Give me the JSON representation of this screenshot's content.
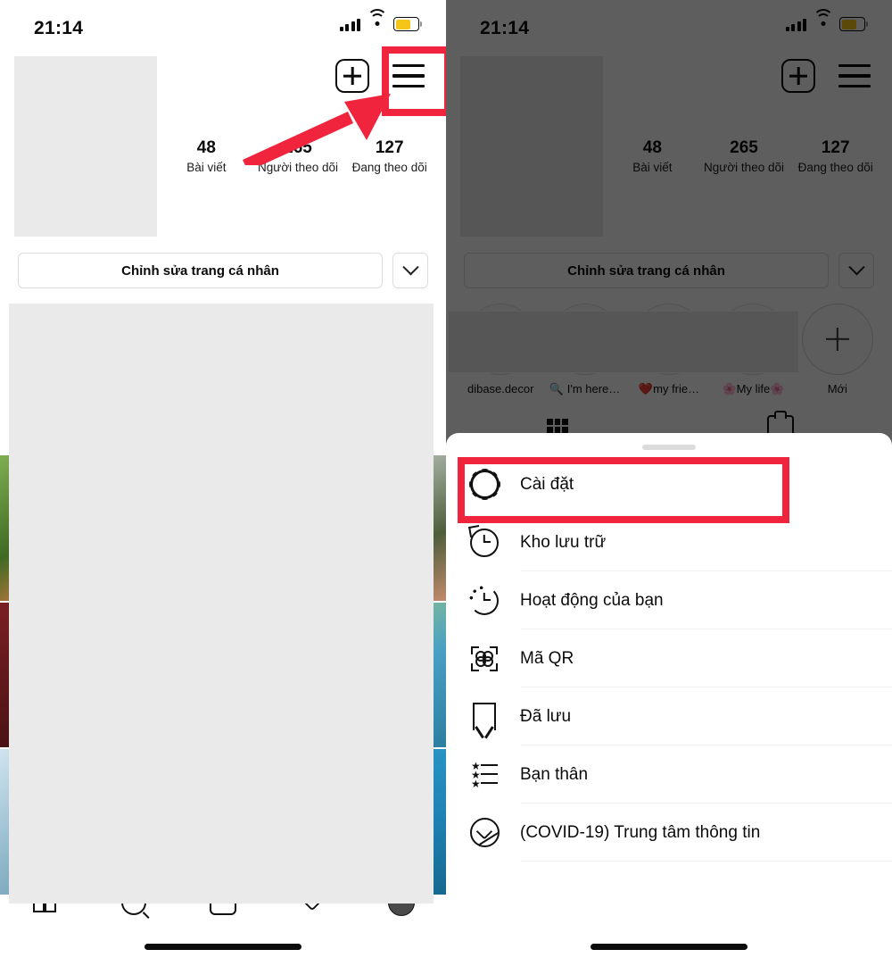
{
  "meta": {
    "app": "Instagram",
    "platform": "iOS",
    "accent_red": "#f0243c",
    "battery_color": "#f5c518"
  },
  "status_bar": {
    "time": "21:14",
    "signal_icon": "cellular-signal-icon",
    "wifi_icon": "wifi-icon",
    "battery_icon": "battery-icon"
  },
  "header": {
    "add_icon": "plus-square-icon",
    "menu_icon": "hamburger-menu-icon"
  },
  "profile": {
    "stats": [
      {
        "value": "48",
        "label": "Bài viết"
      },
      {
        "value": "265",
        "label": "Người theo dõi"
      },
      {
        "value": "127",
        "label": "Đang theo dõi"
      }
    ],
    "edit_button": "Chỉnh sửa trang cá nhân",
    "chevron_icon": "chevron-down-icon",
    "highlights": [
      {
        "name": "dibase.decor",
        "type": "highlight"
      },
      {
        "name": "🔍 I'm here…",
        "type": "highlight"
      },
      {
        "name": "❤️my frie…",
        "type": "highlight"
      },
      {
        "name": "🌸My life🌸",
        "type": "highlight"
      },
      {
        "name": "Mới",
        "type": "new"
      }
    ],
    "tabs": [
      {
        "icon": "grid-icon",
        "label": ""
      },
      {
        "icon": "tagged-camera-icon",
        "label": ""
      }
    ]
  },
  "bottom_nav": [
    {
      "icon": "home-icon"
    },
    {
      "icon": "search-icon"
    },
    {
      "icon": "reels-icon"
    },
    {
      "icon": "activity-heart-icon"
    },
    {
      "icon": "profile-avatar-icon"
    }
  ],
  "sheet": {
    "handle_icon": "drag-handle",
    "items": [
      {
        "icon": "gear-icon",
        "label": "Cài đặt",
        "highlighted": true
      },
      {
        "icon": "archive-clock-icon",
        "label": "Kho lưu trữ",
        "highlighted": false
      },
      {
        "icon": "activity-clock-icon",
        "label": "Hoạt động của bạn",
        "highlighted": false
      },
      {
        "icon": "qr-code-icon",
        "label": "Mã QR",
        "highlighted": false
      },
      {
        "icon": "bookmark-icon",
        "label": "Đã lưu",
        "highlighted": false
      },
      {
        "icon": "close-friends-icon",
        "label": "Bạn thân",
        "highlighted": false
      },
      {
        "icon": "covid-info-icon",
        "label": "(COVID-19) Trung tâm thông tin",
        "highlighted": false
      }
    ]
  },
  "annotations": {
    "menu_highlight_box": "red-box-around-hamburger-menu",
    "menu_arrow": "red-arrow-pointing-to-hamburger-menu",
    "settings_highlight_box": "red-box-around-cai-dat"
  }
}
